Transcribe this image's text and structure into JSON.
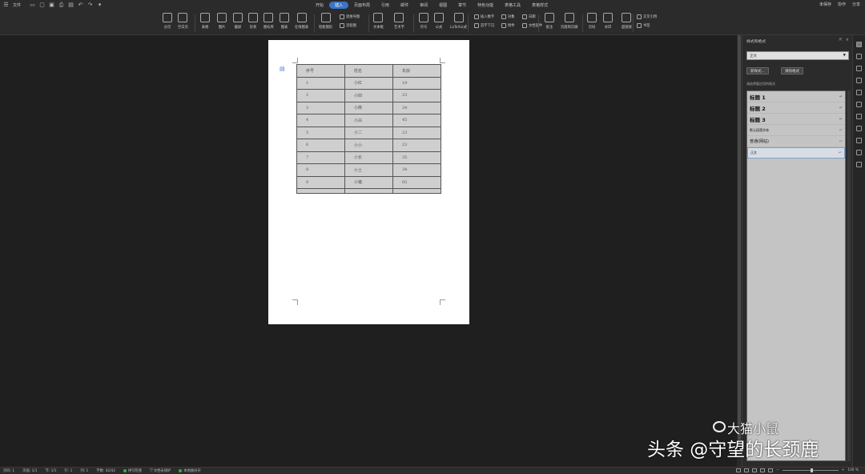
{
  "menubar": {
    "file_label": "文件",
    "tabs": [
      {
        "label": "开始",
        "active": false
      },
      {
        "label": "插入",
        "active": true
      },
      {
        "label": "页面布局",
        "active": false
      },
      {
        "label": "引用",
        "active": false
      },
      {
        "label": "邮件",
        "active": false
      },
      {
        "label": "审阅",
        "active": false
      },
      {
        "label": "视图",
        "active": false
      },
      {
        "label": "章节",
        "active": false
      },
      {
        "label": "特色功能",
        "active": false
      },
      {
        "label": "表格工具",
        "active": false
      },
      {
        "label": "表格样式",
        "active": false
      }
    ],
    "right": {
      "unsaved": "未保存",
      "collab": "协作",
      "share": "分享"
    }
  },
  "ribbon": {
    "buttons": [
      "分页",
      "空白页",
      "表格",
      "图片",
      "截屏",
      "形状",
      "图标库",
      "图表",
      "在线图表",
      "智能图形",
      "文本框",
      "艺术字",
      "符号",
      "公式",
      "LaTeX公式",
      "批注",
      "页眉和页脚",
      "页码",
      "水印",
      "超链接"
    ],
    "small": [
      "思维导图",
      "流程图",
      "插入数字",
      "首字下沉",
      "对象",
      "附件",
      "日期",
      "文档部件",
      "交叉引用",
      "书签"
    ]
  },
  "document": {
    "table": {
      "headers": [
        "序号",
        "姓名",
        "年龄"
      ],
      "rows": [
        [
          "1",
          "小红",
          "19"
        ],
        [
          "2",
          "小四",
          "23"
        ],
        [
          "3",
          "小微",
          "34"
        ],
        [
          "4",
          "小白",
          "45"
        ],
        [
          "5",
          "小二",
          "23"
        ],
        [
          "6",
          "小小",
          "23"
        ],
        [
          "7",
          "小长",
          "35"
        ],
        [
          "8",
          "小土",
          "34"
        ],
        [
          "9",
          "小猪",
          "65"
        ]
      ]
    }
  },
  "panel": {
    "title": "样式和格式",
    "current_style": "正文",
    "new_style_btn": "新样式...",
    "clear_btn": "清除格式",
    "hint": "请选择要应用的格式",
    "styles": [
      {
        "label": "标题 1",
        "kind": "h"
      },
      {
        "label": "标题 2",
        "kind": "h"
      },
      {
        "label": "标题 3",
        "kind": "h"
      },
      {
        "label": "默认段落字体",
        "kind": "small"
      },
      {
        "label": "普通(网站)",
        "kind": "norm"
      },
      {
        "label": "正文",
        "kind": "small",
        "selected": true
      }
    ]
  },
  "statusbar": {
    "page": "页码: 1",
    "pages": "页面: 1/1",
    "section": "节: 1/1",
    "row": "行: 1",
    "col": "列: 1",
    "words": "字数: 42/42",
    "spell": "拼写检查",
    "protect": "文档未保护",
    "backup": "本地备份开",
    "zoom": "100 %"
  },
  "watermark": {
    "line1": "大猫小鼠",
    "line2": "头条 @守望的长颈鹿"
  }
}
